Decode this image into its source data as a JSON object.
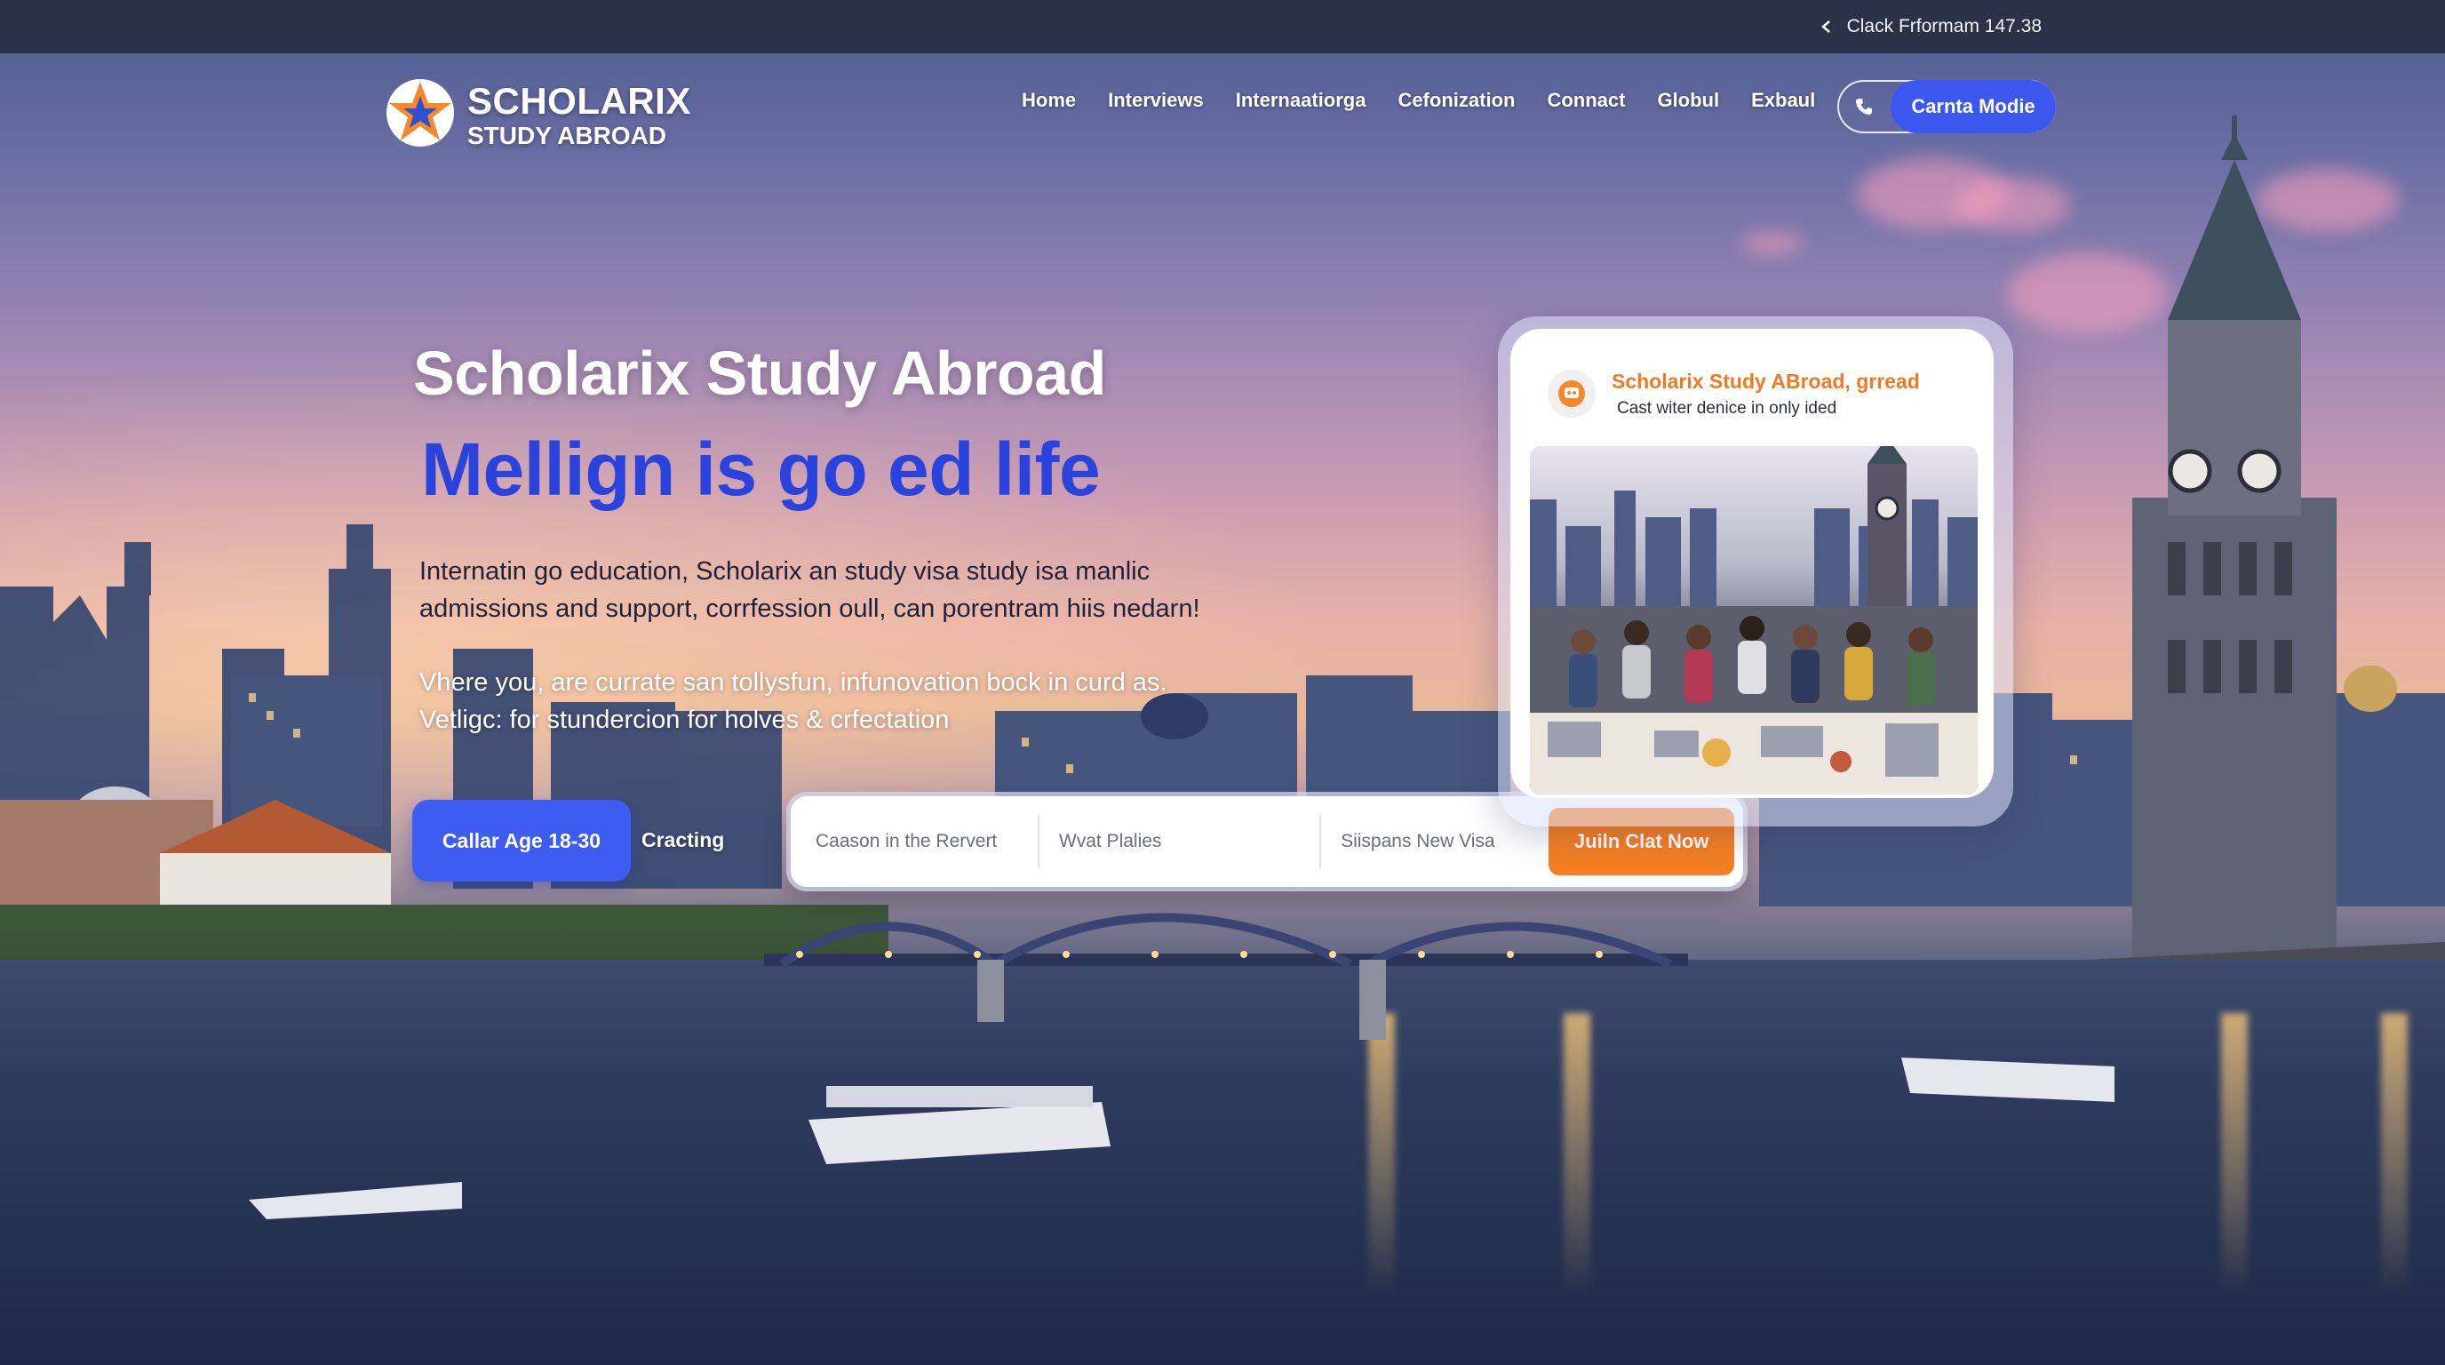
{
  "topbar": {
    "label": "Clack Frformam 147.38"
  },
  "logo": {
    "name": "SCHOLARIX",
    "sub": "STUDY ABROAD"
  },
  "nav": {
    "links": [
      "Home",
      "Interviews",
      "Internaatiorga",
      "Cefonization",
      "Connact",
      "Globul",
      "Exbaul"
    ],
    "cta_label": "Carnta Modie"
  },
  "hero": {
    "title": "Scholarix Study Abroad",
    "tagline": "Mellign is go ed life",
    "desc_line1": "Internatin go education, Scholarix an study visa study isa manlic",
    "desc_line2": "admissions and support, corrfession oull, can porentram hiis nedarn!",
    "sub_line1": "Vhere you, are currate san tollysfun, infunovation bock in curd as.",
    "sub_line2": "Vetligc: for stundercion for holves & crfectation"
  },
  "actions": {
    "age_button": "Callar Age 18-30",
    "secondary": "Cracting"
  },
  "search": {
    "field1": "Caason in the Rervert",
    "field2": "Wvat Plalies",
    "field3": "Siispans New Visa",
    "submit": "Juiln Clat Now"
  },
  "card": {
    "title": "Scholarix Study ABroad, grread",
    "subtitle": "Cast witer denice in only ided"
  },
  "colors": {
    "primary": "#3c56f0",
    "accent": "#f57f22",
    "tagline": "#2a43dc",
    "topbar": "#2b3247"
  }
}
